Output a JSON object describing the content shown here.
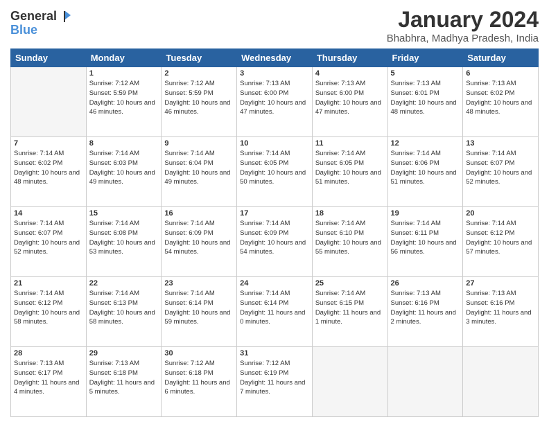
{
  "header": {
    "logo_line1": "General",
    "logo_line2": "Blue",
    "title": "January 2024",
    "location": "Bhabhra, Madhya Pradesh, India"
  },
  "weekdays": [
    "Sunday",
    "Monday",
    "Tuesday",
    "Wednesday",
    "Thursday",
    "Friday",
    "Saturday"
  ],
  "weeks": [
    [
      {
        "day": "",
        "empty": true
      },
      {
        "day": "1",
        "sunrise": "7:12 AM",
        "sunset": "5:59 PM",
        "daylight": "10 hours and 46 minutes."
      },
      {
        "day": "2",
        "sunrise": "7:12 AM",
        "sunset": "5:59 PM",
        "daylight": "10 hours and 46 minutes."
      },
      {
        "day": "3",
        "sunrise": "7:13 AM",
        "sunset": "6:00 PM",
        "daylight": "10 hours and 47 minutes."
      },
      {
        "day": "4",
        "sunrise": "7:13 AM",
        "sunset": "6:00 PM",
        "daylight": "10 hours and 47 minutes."
      },
      {
        "day": "5",
        "sunrise": "7:13 AM",
        "sunset": "6:01 PM",
        "daylight": "10 hours and 48 minutes."
      },
      {
        "day": "6",
        "sunrise": "7:13 AM",
        "sunset": "6:02 PM",
        "daylight": "10 hours and 48 minutes."
      }
    ],
    [
      {
        "day": "7",
        "sunrise": "7:14 AM",
        "sunset": "6:02 PM",
        "daylight": "10 hours and 48 minutes."
      },
      {
        "day": "8",
        "sunrise": "7:14 AM",
        "sunset": "6:03 PM",
        "daylight": "10 hours and 49 minutes."
      },
      {
        "day": "9",
        "sunrise": "7:14 AM",
        "sunset": "6:04 PM",
        "daylight": "10 hours and 49 minutes."
      },
      {
        "day": "10",
        "sunrise": "7:14 AM",
        "sunset": "6:05 PM",
        "daylight": "10 hours and 50 minutes."
      },
      {
        "day": "11",
        "sunrise": "7:14 AM",
        "sunset": "6:05 PM",
        "daylight": "10 hours and 51 minutes."
      },
      {
        "day": "12",
        "sunrise": "7:14 AM",
        "sunset": "6:06 PM",
        "daylight": "10 hours and 51 minutes."
      },
      {
        "day": "13",
        "sunrise": "7:14 AM",
        "sunset": "6:07 PM",
        "daylight": "10 hours and 52 minutes."
      }
    ],
    [
      {
        "day": "14",
        "sunrise": "7:14 AM",
        "sunset": "6:07 PM",
        "daylight": "10 hours and 52 minutes."
      },
      {
        "day": "15",
        "sunrise": "7:14 AM",
        "sunset": "6:08 PM",
        "daylight": "10 hours and 53 minutes."
      },
      {
        "day": "16",
        "sunrise": "7:14 AM",
        "sunset": "6:09 PM",
        "daylight": "10 hours and 54 minutes."
      },
      {
        "day": "17",
        "sunrise": "7:14 AM",
        "sunset": "6:09 PM",
        "daylight": "10 hours and 54 minutes."
      },
      {
        "day": "18",
        "sunrise": "7:14 AM",
        "sunset": "6:10 PM",
        "daylight": "10 hours and 55 minutes."
      },
      {
        "day": "19",
        "sunrise": "7:14 AM",
        "sunset": "6:11 PM",
        "daylight": "10 hours and 56 minutes."
      },
      {
        "day": "20",
        "sunrise": "7:14 AM",
        "sunset": "6:12 PM",
        "daylight": "10 hours and 57 minutes."
      }
    ],
    [
      {
        "day": "21",
        "sunrise": "7:14 AM",
        "sunset": "6:12 PM",
        "daylight": "10 hours and 58 minutes."
      },
      {
        "day": "22",
        "sunrise": "7:14 AM",
        "sunset": "6:13 PM",
        "daylight": "10 hours and 58 minutes."
      },
      {
        "day": "23",
        "sunrise": "7:14 AM",
        "sunset": "6:14 PM",
        "daylight": "10 hours and 59 minutes."
      },
      {
        "day": "24",
        "sunrise": "7:14 AM",
        "sunset": "6:14 PM",
        "daylight": "11 hours and 0 minutes."
      },
      {
        "day": "25",
        "sunrise": "7:14 AM",
        "sunset": "6:15 PM",
        "daylight": "11 hours and 1 minute."
      },
      {
        "day": "26",
        "sunrise": "7:13 AM",
        "sunset": "6:16 PM",
        "daylight": "11 hours and 2 minutes."
      },
      {
        "day": "27",
        "sunrise": "7:13 AM",
        "sunset": "6:16 PM",
        "daylight": "11 hours and 3 minutes."
      }
    ],
    [
      {
        "day": "28",
        "sunrise": "7:13 AM",
        "sunset": "6:17 PM",
        "daylight": "11 hours and 4 minutes."
      },
      {
        "day": "29",
        "sunrise": "7:13 AM",
        "sunset": "6:18 PM",
        "daylight": "11 hours and 5 minutes."
      },
      {
        "day": "30",
        "sunrise": "7:12 AM",
        "sunset": "6:18 PM",
        "daylight": "11 hours and 6 minutes."
      },
      {
        "day": "31",
        "sunrise": "7:12 AM",
        "sunset": "6:19 PM",
        "daylight": "11 hours and 7 minutes."
      },
      {
        "day": "",
        "empty": true
      },
      {
        "day": "",
        "empty": true
      },
      {
        "day": "",
        "empty": true
      }
    ]
  ]
}
